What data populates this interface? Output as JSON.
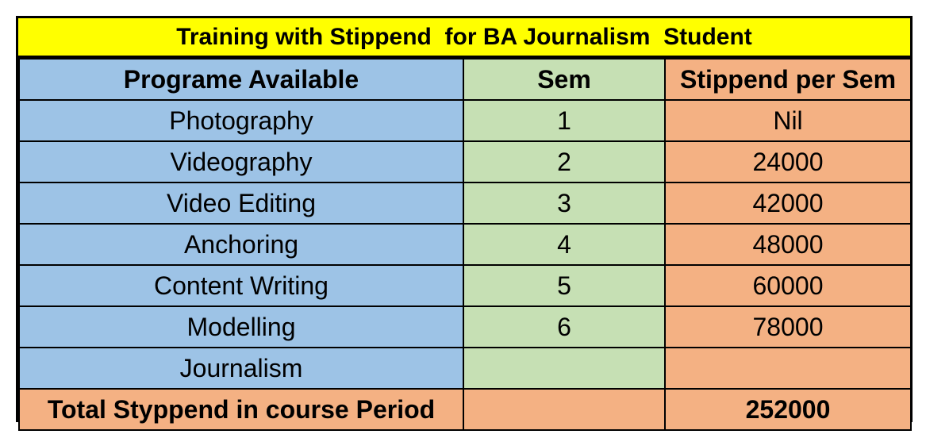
{
  "title": "Training with Stippend  for BA Journalism  Student",
  "headers": {
    "program": "Programe Available",
    "sem": "Sem",
    "stipend": "Stippend per Sem"
  },
  "rows": [
    {
      "program": "Photography",
      "sem": "1",
      "stipend": "Nil"
    },
    {
      "program": "Videography",
      "sem": "2",
      "stipend": "24000"
    },
    {
      "program": "Video Editing",
      "sem": "3",
      "stipend": "42000"
    },
    {
      "program": "Anchoring",
      "sem": "4",
      "stipend": "48000"
    },
    {
      "program": "Content Writing",
      "sem": "5",
      "stipend": "60000"
    },
    {
      "program": "Modelling",
      "sem": "6",
      "stipend": "78000"
    },
    {
      "program": "Journalism",
      "sem": "",
      "stipend": ""
    }
  ],
  "total": {
    "label": "Total Styppend in course Period",
    "value": "252000"
  },
  "colors": {
    "title_bg": "#ffff00",
    "program_col": "#9dc3e6",
    "sem_col": "#c6e0b4",
    "stipend_col": "#f4b183",
    "border": "#000000"
  }
}
